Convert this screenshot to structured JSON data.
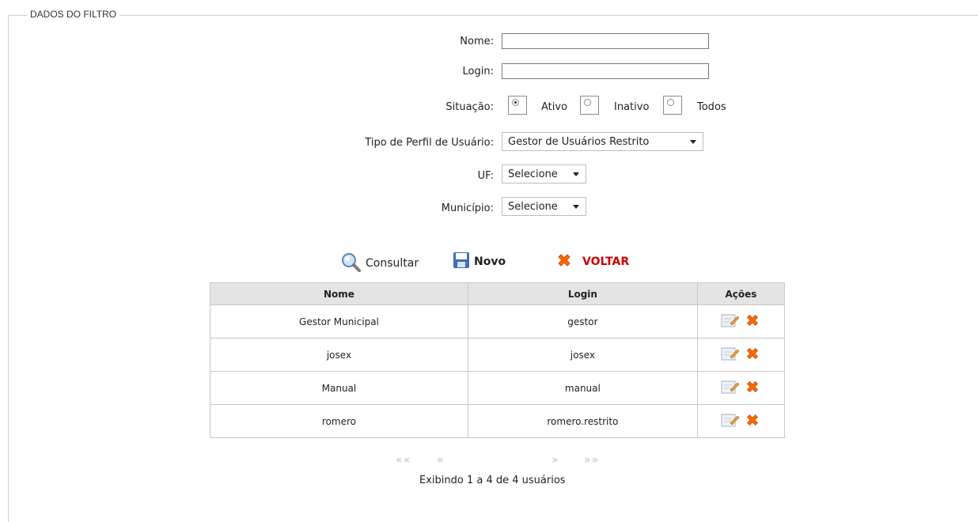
{
  "fieldset": {
    "legend": "DADOS DO FILTRO"
  },
  "filters": {
    "nome_label": "Nome:",
    "nome_value": "",
    "login_label": "Login:",
    "login_value": "",
    "situacao_label": "Situação:",
    "situacao_options": [
      "Ativo",
      "Inativo",
      "Todos"
    ],
    "situacao_selected": "Ativo",
    "tipo_perfil_label": "Tipo de Perfil de Usuário:",
    "tipo_perfil_value": "Gestor de Usuários Restrito",
    "uf_label": "UF:",
    "uf_value": "Selecione",
    "municipio_label": "Município:",
    "municipio_value": "Selecione"
  },
  "actions": {
    "consultar": "Consultar",
    "novo": "Novo",
    "voltar": "VOLTAR"
  },
  "table": {
    "headers": [
      "Nome",
      "Login",
      "Ações"
    ],
    "rows": [
      {
        "nome": "Gestor Municipal",
        "login": "gestor"
      },
      {
        "nome": "josex",
        "login": "josex"
      },
      {
        "nome": "Manual",
        "login": "manual"
      },
      {
        "nome": "romero",
        "login": "romero.restrito"
      }
    ]
  },
  "pagination": {
    "first": "««",
    "prev": "«",
    "next": "»",
    "last": "»»",
    "status": "Exibindo 1 a 4 de 4 usuários"
  },
  "colors": {
    "voltar": "#cc0000",
    "header_bg": "#e4e4e4",
    "border": "#c8c8c8",
    "pager_disabled": "#b9bfc9",
    "delete_icon": "#ff6a00"
  },
  "icons": {
    "consultar": "magnifier-icon",
    "novo": "floppy-disk-icon",
    "voltar": "red-x-icon",
    "edit": "edit-pencil-icon",
    "delete": "delete-x-icon"
  }
}
